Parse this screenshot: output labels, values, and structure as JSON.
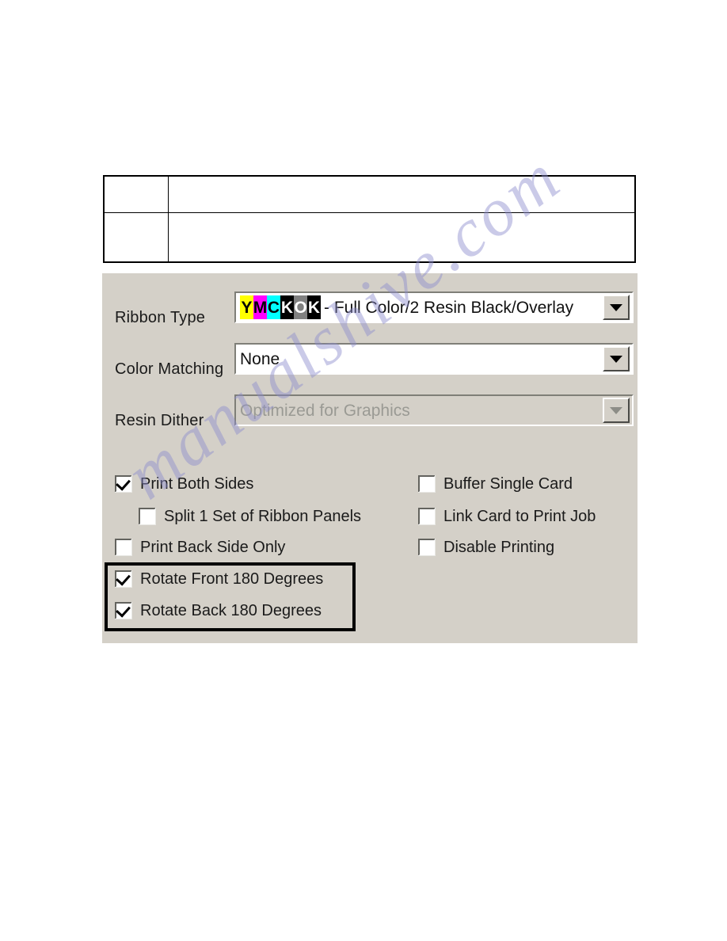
{
  "page": {
    "background": "#ffffff",
    "watermark": "manualshive.com",
    "watermark_color": "#8c8ccd"
  },
  "info_table": {
    "rows": [
      {
        "cells": [
          "",
          ""
        ]
      },
      {
        "cells": [
          "",
          ""
        ]
      }
    ]
  },
  "dialog": {
    "background": "#d4d0c8",
    "fields": [
      {
        "label": "Ribbon Type",
        "value": "YMCKOK - Full Color/2 Resin Black/Overlay",
        "value_suffix": " - Full Color/2 Resin Black/Overlay",
        "enabled": true
      },
      {
        "label": "Color Matching",
        "value": "None",
        "enabled": true
      },
      {
        "label": "Resin Dither",
        "value": "Optimized for Graphics",
        "enabled": false
      }
    ],
    "ribbon_code": {
      "text": "YMCKOK",
      "panels": [
        {
          "letter": "Y",
          "bg": "#ffff00",
          "fg": "#000000"
        },
        {
          "letter": "M",
          "bg": "#ff00ff",
          "fg": "#000000"
        },
        {
          "letter": "C",
          "bg": "#00ffff",
          "fg": "#000000"
        },
        {
          "letter": "K",
          "bg": "#000000",
          "fg": "#ffffff"
        },
        {
          "letter": "O",
          "bg": "#808080",
          "fg": "#ffffff"
        },
        {
          "letter": "K",
          "bg": "#000000",
          "fg": "#ffffff"
        }
      ]
    },
    "checkboxes_left": [
      {
        "label": "Print Both Sides",
        "checked": true,
        "indented": false
      },
      {
        "label": "Split 1 Set of Ribbon Panels",
        "checked": false,
        "indented": true
      },
      {
        "label": "Print Back Side Only",
        "checked": false,
        "indented": false
      },
      {
        "label": "Rotate Front 180 Degrees",
        "checked": true,
        "indented": false
      },
      {
        "label": "Rotate Back 180 Degrees",
        "checked": true,
        "indented": false
      }
    ],
    "checkboxes_right": [
      {
        "label": "Buffer Single Card",
        "checked": false
      },
      {
        "label": "Link Card to Print Job",
        "checked": false
      },
      {
        "label": "Disable Printing",
        "checked": false
      }
    ],
    "highlight": {
      "color": "#000000",
      "covers": [
        "Rotate Front 180 Degrees",
        "Rotate Back 180 Degrees"
      ]
    }
  }
}
